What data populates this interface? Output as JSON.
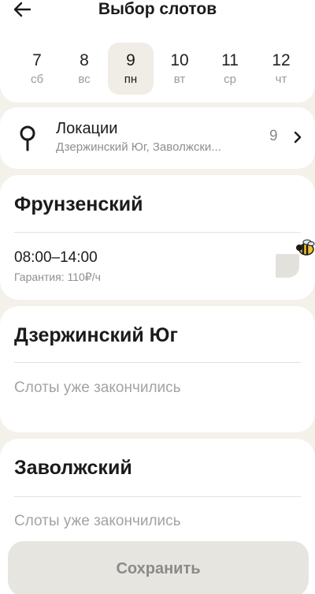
{
  "header": {
    "title": "Выбор слотов",
    "back_icon": "arrow-left-icon"
  },
  "dates": [
    {
      "num": "7",
      "dow": "сб",
      "selected": false
    },
    {
      "num": "8",
      "dow": "вс",
      "selected": false
    },
    {
      "num": "9",
      "dow": "пн",
      "selected": true
    },
    {
      "num": "10",
      "dow": "вт",
      "selected": false
    },
    {
      "num": "11",
      "dow": "ср",
      "selected": false
    },
    {
      "num": "12",
      "dow": "чт",
      "selected": false
    }
  ],
  "locations": {
    "title": "Локации",
    "subtitle": "Дзержинский Юг, Заволжски...",
    "count": "9",
    "icon": "map-pin-icon",
    "chevron_icon": "chevron-right-icon"
  },
  "sections": [
    {
      "title": "Фрунзенский",
      "slots": [
        {
          "time": "08:00–14:00",
          "guarantee": "Гарантия: 110₽/ч"
        }
      ]
    },
    {
      "title": "Дзержинский Юг",
      "empty": "Слоты уже закончились"
    },
    {
      "title": "Заволжский",
      "empty": "Слоты уже закончились"
    }
  ],
  "save_button": {
    "label": "Сохранить"
  },
  "colors": {
    "background": "#f3f1ea",
    "card": "#ffffff",
    "selected_date": "#efede6",
    "button_disabled": "#e6e5e0",
    "muted_text": "#8f8f8f"
  }
}
